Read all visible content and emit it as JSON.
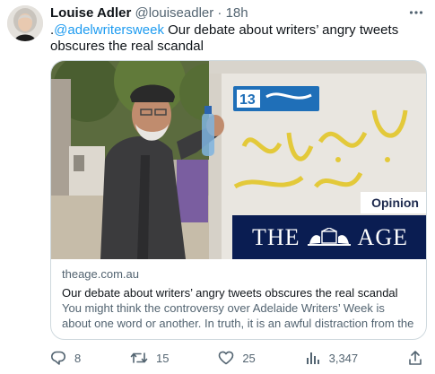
{
  "tweet": {
    "author_name": "Louise Adler",
    "handle": "@louiseadler",
    "separator": "·",
    "time": "18h",
    "text_prefix": ".",
    "mention": "@adelwritersweek",
    "text": " Our debate about writers’ angry tweets obscures the real scandal"
  },
  "card": {
    "opinion_label": "Opinion",
    "masthead_left": "THE",
    "masthead_right": "AGE",
    "wall_sign_number": "13",
    "domain": "theage.com.au",
    "title": "Our debate about writers’ angry tweets obscures the real scandal",
    "description": "You might think the controversy over Adelaide Writers’ Week is about one word or another. In truth, it is an awful distraction from the ..."
  },
  "actions": {
    "replies": "8",
    "retweets": "15",
    "likes": "25",
    "views": "3,347"
  },
  "icons": [
    "more-icon",
    "reply-icon",
    "retweet-icon",
    "like-icon",
    "views-icon",
    "share-icon"
  ],
  "colors": {
    "link": "#1d9bf0",
    "secondary_text": "#536471",
    "masthead_bg": "#0a1d52",
    "opinion_text": "#1e2a4e",
    "graffiti": "#e3c93a",
    "sign_blue": "#1f6fb8"
  }
}
